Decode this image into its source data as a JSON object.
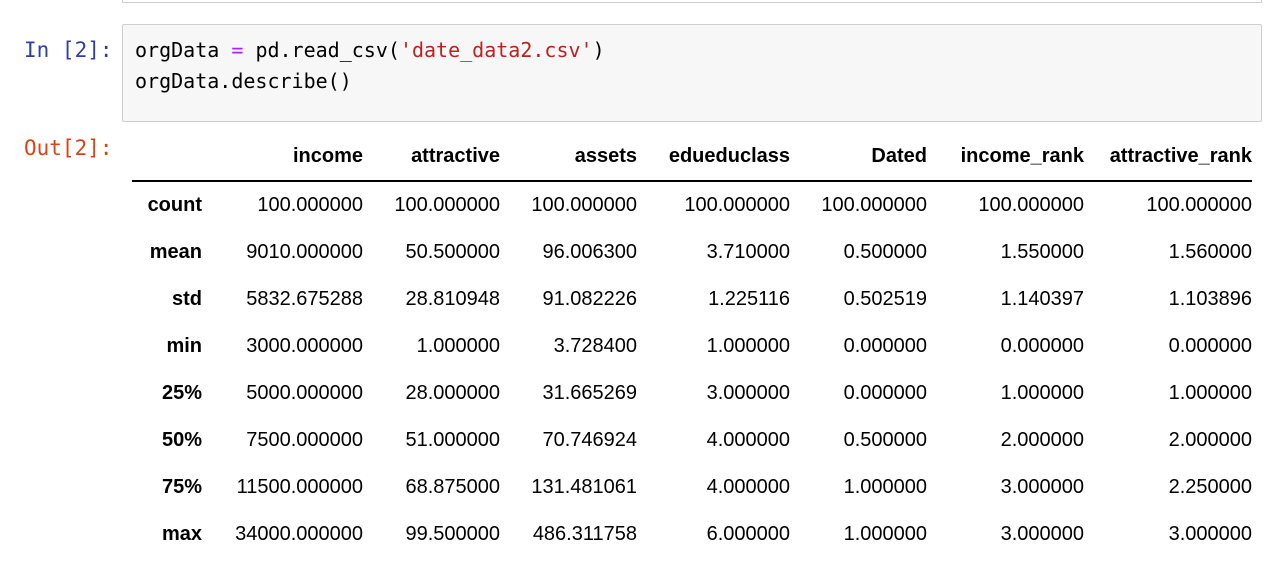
{
  "notebook": {
    "input_prompt": "In [2]:",
    "output_prompt": "Out[2]:",
    "code": {
      "line1": {
        "var": "orgData",
        "op": "=",
        "call": "pd.read_csv(",
        "str": "'date_data2.csv'",
        "close": ")"
      },
      "line2": "orgData.describe()"
    }
  },
  "dataframe": {
    "columns": [
      "income",
      "attractive",
      "assets",
      "edueduclass",
      "Dated",
      "income_rank",
      "attractive_rank"
    ],
    "rows": [
      {
        "index": "count",
        "values": [
          "100.000000",
          "100.000000",
          "100.000000",
          "100.000000",
          "100.000000",
          "100.000000",
          "100.000000"
        ]
      },
      {
        "index": "mean",
        "values": [
          "9010.000000",
          "50.500000",
          "96.006300",
          "3.710000",
          "0.500000",
          "1.550000",
          "1.560000"
        ]
      },
      {
        "index": "std",
        "values": [
          "5832.675288",
          "28.810948",
          "91.082226",
          "1.225116",
          "0.502519",
          "1.140397",
          "1.103896"
        ]
      },
      {
        "index": "min",
        "values": [
          "3000.000000",
          "1.000000",
          "3.728400",
          "1.000000",
          "0.000000",
          "0.000000",
          "0.000000"
        ]
      },
      {
        "index": "25%",
        "values": [
          "5000.000000",
          "28.000000",
          "31.665269",
          "3.000000",
          "0.000000",
          "1.000000",
          "1.000000"
        ]
      },
      {
        "index": "50%",
        "values": [
          "7500.000000",
          "51.000000",
          "70.746924",
          "4.000000",
          "0.500000",
          "2.000000",
          "2.000000"
        ]
      },
      {
        "index": "75%",
        "values": [
          "11500.000000",
          "68.875000",
          "131.481061",
          "4.000000",
          "1.000000",
          "3.000000",
          "2.250000"
        ]
      },
      {
        "index": "max",
        "values": [
          "34000.000000",
          "99.500000",
          "486.311758",
          "6.000000",
          "1.000000",
          "3.000000",
          "3.000000"
        ]
      }
    ]
  }
}
